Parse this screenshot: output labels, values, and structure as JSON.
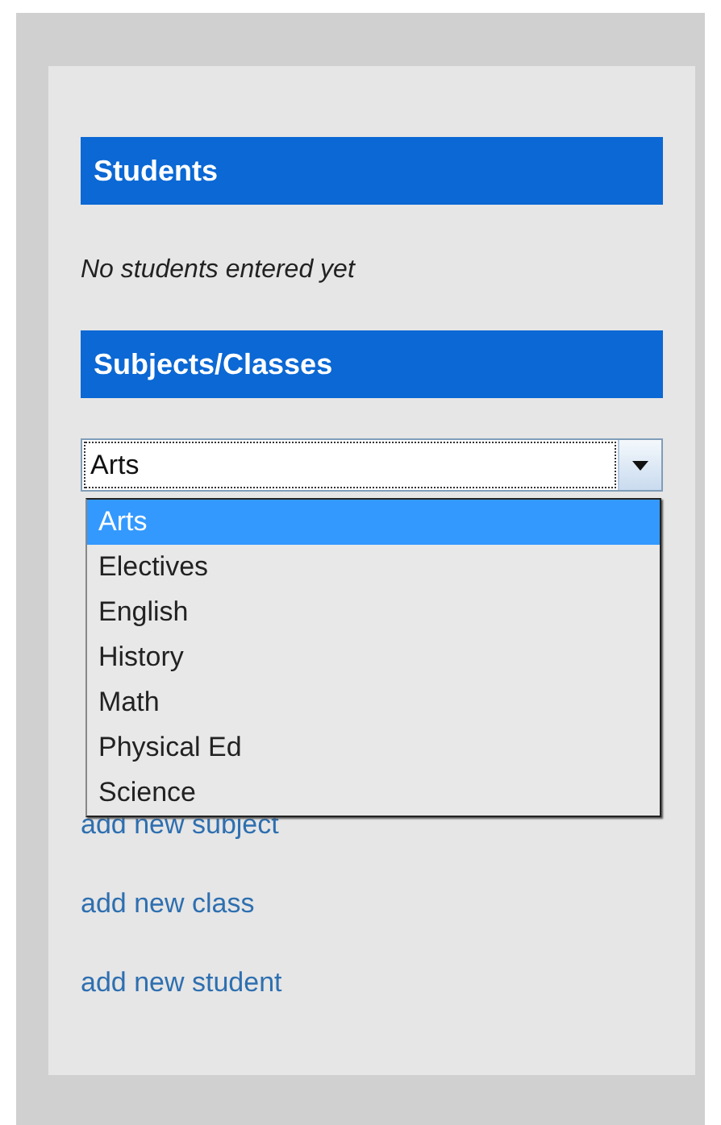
{
  "students": {
    "title": "Students",
    "empty_message": "No students entered yet"
  },
  "subjects": {
    "title": "Subjects/Classes",
    "select": {
      "value": "Arts",
      "expanded": true,
      "options": [
        {
          "label": "Arts",
          "selected": true
        },
        {
          "label": "Electives",
          "selected": false
        },
        {
          "label": "English",
          "selected": false
        },
        {
          "label": "History",
          "selected": false
        },
        {
          "label": "Math",
          "selected": false
        },
        {
          "label": "Physical Ed",
          "selected": false
        },
        {
          "label": "Science",
          "selected": false
        }
      ]
    }
  },
  "links": [
    "add new subject",
    "add new class",
    "add new student"
  ]
}
